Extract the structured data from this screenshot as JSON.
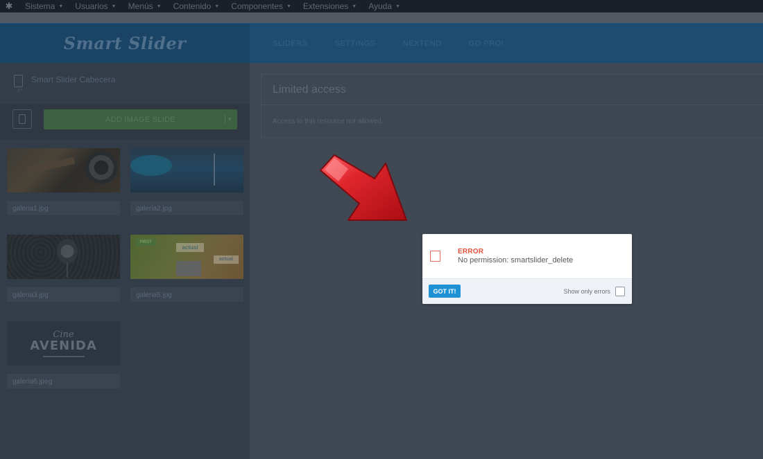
{
  "topmenu": {
    "items": [
      {
        "label": "Sistema"
      },
      {
        "label": "Usuarios"
      },
      {
        "label": "Menús"
      },
      {
        "label": "Contenido"
      },
      {
        "label": "Componentes"
      },
      {
        "label": "Extensiones"
      },
      {
        "label": "Ayuda"
      }
    ]
  },
  "brand": {
    "logo_text": "Smart Slider"
  },
  "nav": {
    "items": [
      {
        "label": "SLIDERS"
      },
      {
        "label": "SETTINGS"
      },
      {
        "label": "NEXTEND"
      },
      {
        "label": "GO PRO!"
      }
    ]
  },
  "sidebar": {
    "slider_name": "Smart Slider Cabecera",
    "slider_id": "#7",
    "add_button": "ADD IMAGE SLIDE",
    "slides": [
      {
        "label": "galeria1.jpg"
      },
      {
        "label": "galeria2.jpg"
      },
      {
        "label": "galeria3.jpg"
      },
      {
        "label": "galeria5.jpg",
        "badge": "FIRST",
        "logo_a": "actual",
        "logo_b": "actual"
      },
      {
        "label": "galeria6.jpeg",
        "cine": "Cine",
        "avenida": "AVENIDA"
      }
    ]
  },
  "main": {
    "title": "Limited access",
    "message": "Access to this resource not allowed."
  },
  "notification": {
    "title": "ERROR",
    "message": "No permission: smartslider_delete",
    "button": "GOT IT!",
    "toggle_label": "Show only errors"
  },
  "colors": {
    "error": "#e2513a",
    "primary_button": "#1f92d6",
    "arrow": "#c4161c"
  }
}
